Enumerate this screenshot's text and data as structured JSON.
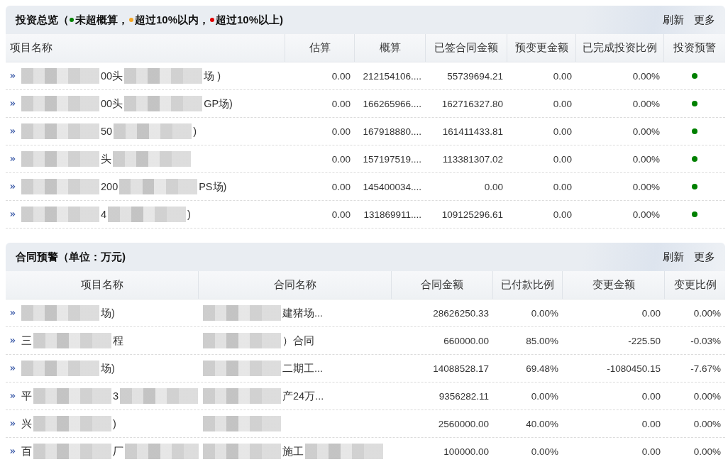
{
  "panels": [
    {
      "title": "投资总览（",
      "legend": [
        {
          "color": "#008000",
          "label": "未超概算，"
        },
        {
          "color": "#f5a623",
          "label": "超过10%以内，"
        },
        {
          "color": "#e00000",
          "label": "超过10%以上)"
        }
      ],
      "actions": [
        "刷新",
        "更多"
      ],
      "columns": [
        "项目名称",
        "估算",
        "概算",
        "已签合同金额",
        "预变更金额",
        "已完成投资比例",
        "投资预警"
      ],
      "rows": [
        {
          "cells": [
            {
              "kind": "name",
              "parts": [
                {
                  "kind": "blur"
                },
                {
                  "kind": "text",
                  "text": "00头"
                },
                {
                  "kind": "blur"
                },
                {
                  "kind": "text",
                  "text": "场 )"
                }
              ]
            },
            {
              "kind": "num",
              "text": "0.00"
            },
            {
              "kind": "num",
              "text": "212154106...."
            },
            {
              "kind": "num",
              "text": "55739694.21"
            },
            {
              "kind": "num",
              "text": "0.00"
            },
            {
              "kind": "num",
              "text": "0.00%"
            },
            {
              "kind": "dot",
              "color": "#008000"
            }
          ]
        },
        {
          "cells": [
            {
              "kind": "name",
              "parts": [
                {
                  "kind": "blur"
                },
                {
                  "kind": "text",
                  "text": "00头"
                },
                {
                  "kind": "blur"
                },
                {
                  "kind": "text",
                  "text": "GP场)"
                }
              ]
            },
            {
              "kind": "num",
              "text": "0.00"
            },
            {
              "kind": "num",
              "text": "166265966...."
            },
            {
              "kind": "num",
              "text": "162716327.80"
            },
            {
              "kind": "num",
              "text": "0.00"
            },
            {
              "kind": "num",
              "text": "0.00%"
            },
            {
              "kind": "dot",
              "color": "#008000"
            }
          ]
        },
        {
          "cells": [
            {
              "kind": "name",
              "parts": [
                {
                  "kind": "blur"
                },
                {
                  "kind": "text",
                  "text": "50"
                },
                {
                  "kind": "blur"
                },
                {
                  "kind": "text",
                  "text": ")"
                }
              ]
            },
            {
              "kind": "num",
              "text": "0.00"
            },
            {
              "kind": "num",
              "text": "167918880...."
            },
            {
              "kind": "num",
              "text": "161411433.81"
            },
            {
              "kind": "num",
              "text": "0.00"
            },
            {
              "kind": "num",
              "text": "0.00%"
            },
            {
              "kind": "dot",
              "color": "#008000"
            }
          ]
        },
        {
          "cells": [
            {
              "kind": "name",
              "parts": [
                {
                  "kind": "blur"
                },
                {
                  "kind": "text",
                  "text": "头"
                },
                {
                  "kind": "blur"
                }
              ]
            },
            {
              "kind": "num",
              "text": "0.00"
            },
            {
              "kind": "num",
              "text": "157197519...."
            },
            {
              "kind": "num",
              "text": "113381307.02"
            },
            {
              "kind": "num",
              "text": "0.00"
            },
            {
              "kind": "num",
              "text": "0.00%"
            },
            {
              "kind": "dot",
              "color": "#008000"
            }
          ]
        },
        {
          "cells": [
            {
              "kind": "name",
              "parts": [
                {
                  "kind": "blur"
                },
                {
                  "kind": "text",
                  "text": "200"
                },
                {
                  "kind": "blur"
                },
                {
                  "kind": "text",
                  "text": "PS场)"
                }
              ]
            },
            {
              "kind": "num",
              "text": "0.00"
            },
            {
              "kind": "num",
              "text": "145400034...."
            },
            {
              "kind": "num",
              "text": "0.00"
            },
            {
              "kind": "num",
              "text": "0.00"
            },
            {
              "kind": "num",
              "text": "0.00%"
            },
            {
              "kind": "dot",
              "color": "#008000"
            }
          ]
        },
        {
          "cells": [
            {
              "kind": "name",
              "parts": [
                {
                  "kind": "blur"
                },
                {
                  "kind": "text",
                  "text": "4"
                },
                {
                  "kind": "blur"
                },
                {
                  "kind": "text",
                  "text": ")"
                }
              ]
            },
            {
              "kind": "num",
              "text": "0.00"
            },
            {
              "kind": "num",
              "text": "131869911...."
            },
            {
              "kind": "num",
              "text": "109125296.61"
            },
            {
              "kind": "num",
              "text": "0.00"
            },
            {
              "kind": "num",
              "text": "0.00%"
            },
            {
              "kind": "dot",
              "color": "#008000"
            }
          ]
        }
      ]
    },
    {
      "title": "合同预警（单位：万元)",
      "actions": [
        "刷新",
        "更多"
      ],
      "columns": [
        "项目名称",
        "合同名称",
        "合同金额",
        "已付款比例",
        "变更金额",
        "变更比例"
      ],
      "rows": [
        {
          "cells": [
            {
              "kind": "name",
              "parts": [
                {
                  "kind": "blur"
                },
                {
                  "kind": "text",
                  "text": "场)"
                }
              ]
            },
            {
              "kind": "plain",
              "parts": [
                {
                  "kind": "blur"
                },
                {
                  "kind": "text",
                  "text": "建猪场..."
                }
              ]
            },
            {
              "kind": "num",
              "text": "28626250.33"
            },
            {
              "kind": "num",
              "text": "0.00%"
            },
            {
              "kind": "num",
              "text": "0.00"
            },
            {
              "kind": "num",
              "text": "0.00%"
            }
          ]
        },
        {
          "cells": [
            {
              "kind": "name",
              "parts": [
                {
                  "kind": "text",
                  "text": "三"
                },
                {
                  "kind": "blur"
                },
                {
                  "kind": "text",
                  "text": "程"
                }
              ]
            },
            {
              "kind": "plain",
              "parts": [
                {
                  "kind": "blur"
                },
                {
                  "kind": "text",
                  "text": "）合同"
                }
              ]
            },
            {
              "kind": "num",
              "text": "660000.00"
            },
            {
              "kind": "num",
              "text": "85.00%"
            },
            {
              "kind": "num",
              "text": "-225.50"
            },
            {
              "kind": "num",
              "text": "-0.03%"
            }
          ]
        },
        {
          "cells": [
            {
              "kind": "name",
              "parts": [
                {
                  "kind": "blur"
                },
                {
                  "kind": "text",
                  "text": "场)"
                }
              ]
            },
            {
              "kind": "plain",
              "parts": [
                {
                  "kind": "blur"
                },
                {
                  "kind": "text",
                  "text": "二期工..."
                }
              ]
            },
            {
              "kind": "num",
              "text": "14088528.17"
            },
            {
              "kind": "num",
              "text": "69.48%"
            },
            {
              "kind": "num",
              "text": "-1080450.15"
            },
            {
              "kind": "num",
              "text": "-7.67%"
            }
          ]
        },
        {
          "cells": [
            {
              "kind": "name",
              "parts": [
                {
                  "kind": "text",
                  "text": "平"
                },
                {
                  "kind": "blur"
                },
                {
                  "kind": "text",
                  "text": "3"
                },
                {
                  "kind": "blur"
                }
              ]
            },
            {
              "kind": "plain",
              "parts": [
                {
                  "kind": "blur"
                },
                {
                  "kind": "text",
                  "text": "产24万..."
                }
              ]
            },
            {
              "kind": "num",
              "text": "9356282.11"
            },
            {
              "kind": "num",
              "text": "0.00%"
            },
            {
              "kind": "num",
              "text": "0.00"
            },
            {
              "kind": "num",
              "text": "0.00%"
            }
          ]
        },
        {
          "cells": [
            {
              "kind": "name",
              "parts": [
                {
                  "kind": "text",
                  "text": "兴"
                },
                {
                  "kind": "blur"
                },
                {
                  "kind": "text",
                  "text": ")"
                }
              ]
            },
            {
              "kind": "plain",
              "parts": [
                {
                  "kind": "blur"
                }
              ]
            },
            {
              "kind": "num",
              "text": "2560000.00"
            },
            {
              "kind": "num",
              "text": "40.00%"
            },
            {
              "kind": "num",
              "text": "0.00"
            },
            {
              "kind": "num",
              "text": "0.00%"
            }
          ]
        },
        {
          "cells": [
            {
              "kind": "name",
              "parts": [
                {
                  "kind": "text",
                  "text": "百"
                },
                {
                  "kind": "blur"
                },
                {
                  "kind": "text",
                  "text": "厂"
                },
                {
                  "kind": "blur"
                }
              ]
            },
            {
              "kind": "plain",
              "parts": [
                {
                  "kind": "blur"
                },
                {
                  "kind": "text",
                  "text": "施工"
                },
                {
                  "kind": "blur"
                }
              ]
            },
            {
              "kind": "num",
              "text": "100000.00"
            },
            {
              "kind": "num",
              "text": "0.00%"
            },
            {
              "kind": "num",
              "text": "0.00"
            },
            {
              "kind": "num",
              "text": "0.00%"
            }
          ]
        }
      ]
    }
  ]
}
